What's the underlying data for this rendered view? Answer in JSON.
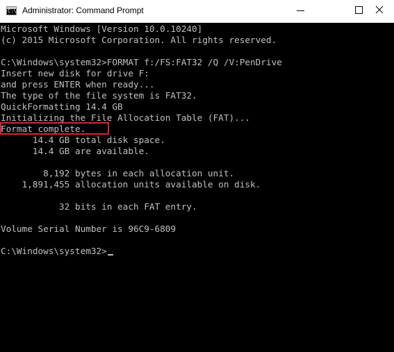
{
  "window": {
    "title": "Administrator: Command Prompt",
    "icon": "cmd-icon",
    "controls": {
      "minimize": "minimize-icon",
      "maximize": "maximize-icon",
      "close": "close-icon"
    }
  },
  "console": {
    "lines": [
      "Microsoft Windows [Version 10.0.10240]",
      "(c) 2015 Microsoft Corporation. All rights reserved.",
      "",
      "C:\\Windows\\system32>FORMAT f:/FS:FAT32 /Q /V:PenDrive",
      "Insert new disk for drive F:",
      "and press ENTER when ready...",
      "The type of the file system is FAT32.",
      "QuickFormatting 14.4 GB",
      "Initializing the File Allocation Table (FAT)...",
      "Format complete.",
      "      14.4 GB total disk space.",
      "      14.4 GB are available.",
      "",
      "        8,192 bytes in each allocation unit.",
      "    1,891,455 allocation units available on disk.",
      "",
      "           32 bits in each FAT entry.",
      "",
      "Volume Serial Number is 96C9-6809",
      "",
      "C:\\Windows\\system32>"
    ],
    "highlighted_line": "Format complete."
  },
  "colors": {
    "background": "#000000",
    "text": "#c0c0c0",
    "highlight_border": "#d7262f",
    "titlebar": "#ffffff"
  }
}
